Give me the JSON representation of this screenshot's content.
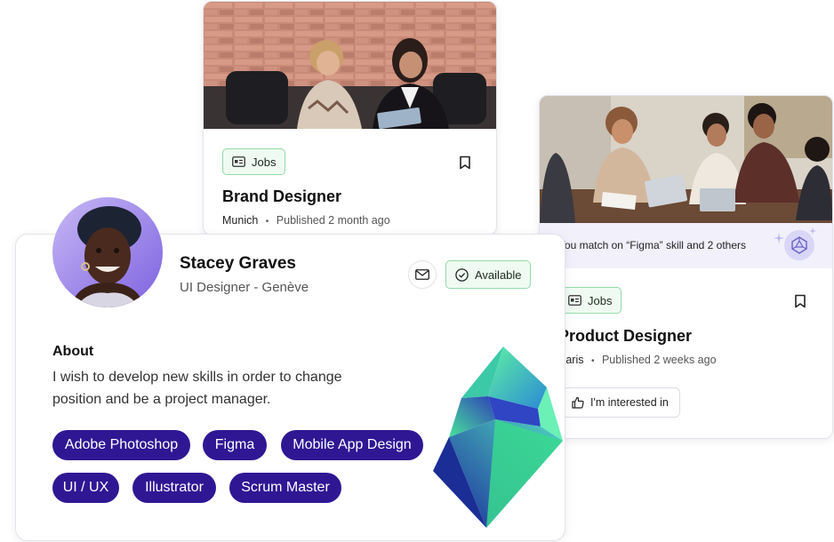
{
  "brand_card": {
    "tag_label": "Jobs",
    "title": "Brand Designer",
    "city": "Munich",
    "published": "Published 2 month ago"
  },
  "product_card": {
    "match_text": "You match on “Figma” skill and 2 others",
    "tag_label": "Jobs",
    "title": "Product Designer",
    "city": "Paris",
    "published": "Published 2 weeks ago",
    "interest_label": "I'm interested in"
  },
  "profile": {
    "name": "Stacey Graves",
    "role": "UI Designer - Genève",
    "status_label": "Available",
    "about_heading": "About",
    "about_text_line1": "I wish to develop new skills in order to change",
    "about_text_line2": "position and be a project manager.",
    "skills": [
      "Adobe Photoshop",
      "Figma",
      "Mobile App Design",
      "UI / UX",
      "Illustrator",
      "Scrum Master"
    ]
  },
  "separator": "•",
  "colors": {
    "skill_pill": "#2f1794",
    "tag_border": "#94d9a8",
    "tag_bg": "#effbf2",
    "match_banner": "#f1f0fb"
  },
  "icons": [
    "id-card-icon",
    "bookmark-icon",
    "mail-icon",
    "check-circle-icon",
    "thumbs-up-icon",
    "polyhedron-icon",
    "sparkle-icon",
    "crystal-gem"
  ]
}
